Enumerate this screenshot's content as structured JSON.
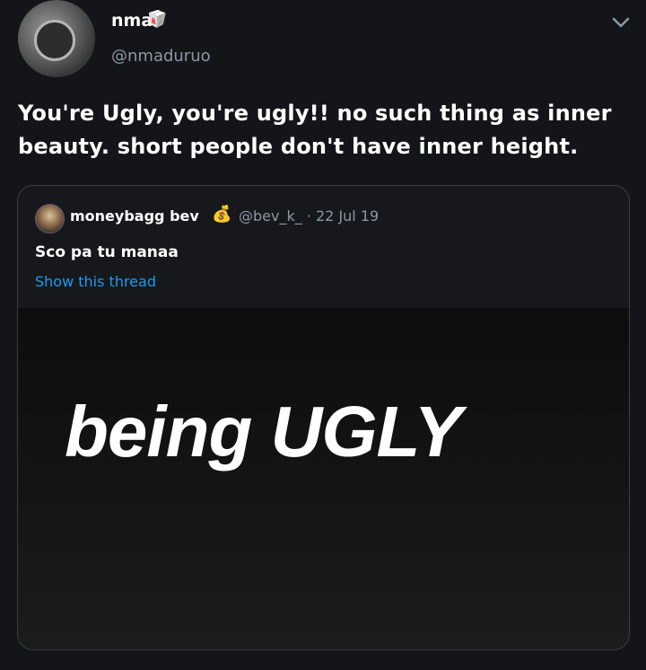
{
  "author": {
    "display_name": "nma",
    "name_emoji": "🥡",
    "handle": "@nmaduruo",
    "avatar_icon": "avatar-photo"
  },
  "tweet": {
    "text": "You're Ugly, you're ugly!! no such thing as inner beauty. short people don't have inner height."
  },
  "menu": {
    "icon": "chevron-down-icon"
  },
  "quoted_tweet": {
    "display_name": "moneybagg bev",
    "name_emoji": "💰",
    "handle_and_date": "@bev_k_ · 22 Jul 19",
    "text": "Sco pa tu manaa",
    "show_thread_label": "Show this thread",
    "media_text": "being UGLY"
  },
  "colors": {
    "background": "#141519",
    "link": "#1d9bf0",
    "muted": "#8b98a5",
    "border": "#3a3f45"
  }
}
